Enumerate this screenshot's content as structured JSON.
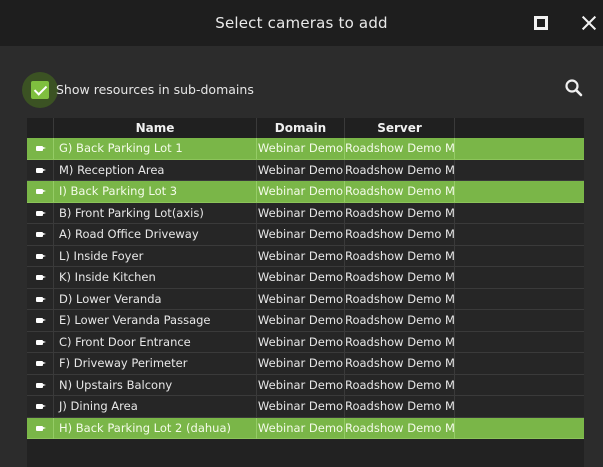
{
  "dialog": {
    "title": "Select cameras to add"
  },
  "filter": {
    "subdomains_label": "Show resources in sub-domains",
    "subdomains_checked": true
  },
  "colors": {
    "accent": "#7ab648",
    "titlebar": "#1e1e1e",
    "background": "#2c2c2c"
  },
  "table": {
    "columns": [
      "Name",
      "Domain",
      "Server",
      ""
    ],
    "rows": [
      {
        "name": "G) Back Parking Lot 1",
        "domain": "Webinar Demo",
        "server": "Roadshow Demo MSTR",
        "selected": true
      },
      {
        "name": "M) Reception Area",
        "domain": "Webinar Demo",
        "server": "Roadshow Demo MSTR",
        "selected": false
      },
      {
        "name": "I) Back Parking Lot 3",
        "domain": "Webinar Demo",
        "server": "Roadshow Demo MSTR",
        "selected": true
      },
      {
        "name": "B) Front Parking Lot(axis)",
        "domain": "Webinar Demo",
        "server": "Roadshow Demo MSTR",
        "selected": false
      },
      {
        "name": "A) Road Office Driveway",
        "domain": "Webinar Demo",
        "server": "Roadshow Demo MSTR",
        "selected": false
      },
      {
        "name": "L) Inside Foyer",
        "domain": "Webinar Demo",
        "server": "Roadshow Demo MSTR",
        "selected": false
      },
      {
        "name": "K) Inside Kitchen",
        "domain": "Webinar Demo",
        "server": "Roadshow Demo MSTR",
        "selected": false
      },
      {
        "name": "D) Lower Veranda",
        "domain": "Webinar Demo",
        "server": "Roadshow Demo MSTR",
        "selected": false
      },
      {
        "name": "E) Lower Veranda Passage",
        "domain": "Webinar Demo",
        "server": "Roadshow Demo MSTR",
        "selected": false
      },
      {
        "name": "C) Front Door Entrance",
        "domain": "Webinar Demo",
        "server": "Roadshow Demo MSTR",
        "selected": false
      },
      {
        "name": "F) Driveway Perimeter",
        "domain": "Webinar Demo",
        "server": "Roadshow Demo MSTR",
        "selected": false
      },
      {
        "name": "N) Upstairs Balcony",
        "domain": "Webinar Demo",
        "server": "Roadshow Demo MSTR",
        "selected": false
      },
      {
        "name": "J) Dining Area",
        "domain": "Webinar Demo",
        "server": "Roadshow Demo MSTR",
        "selected": false
      },
      {
        "name": "H) Back Parking Lot 2 (dahua)",
        "domain": "Webinar Demo",
        "server": "Roadshow Demo MSTR",
        "selected": true
      }
    ]
  },
  "icons": {
    "maximize": "maximize-icon",
    "close": "close-icon",
    "search": "search-icon",
    "camera": "camera-icon",
    "checkbox": "checkbox-checked-icon"
  }
}
